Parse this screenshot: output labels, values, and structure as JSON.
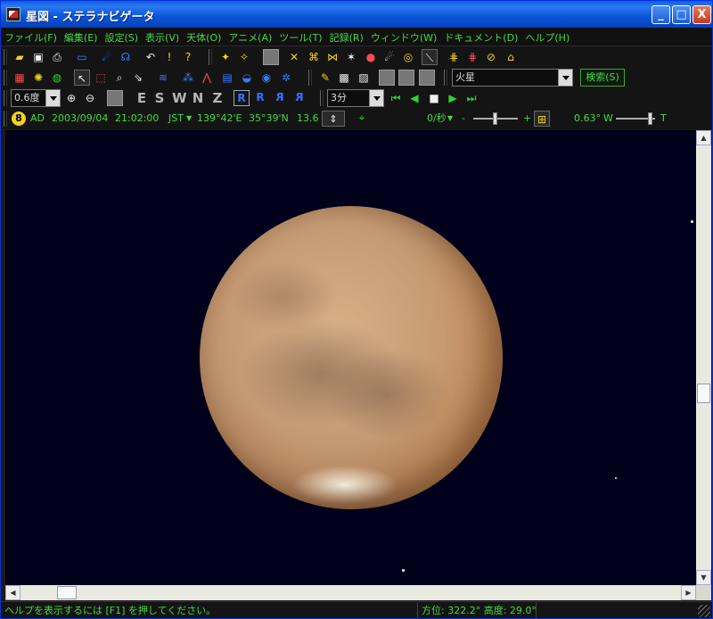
{
  "window": {
    "title": "星図 - ステラナビゲータ",
    "min_label": "_",
    "max_label": "□",
    "close_label": "X"
  },
  "menu": [
    {
      "id": "file",
      "label": "ファイル(F)"
    },
    {
      "id": "edit",
      "label": "編集(E)"
    },
    {
      "id": "settings",
      "label": "設定(S)"
    },
    {
      "id": "view",
      "label": "表示(V)"
    },
    {
      "id": "object",
      "label": "天体(O)"
    },
    {
      "id": "anime",
      "label": "アニメ(A)"
    },
    {
      "id": "tools",
      "label": "ツール(T)"
    },
    {
      "id": "record",
      "label": "記録(R)"
    },
    {
      "id": "window",
      "label": "ウィンドウ(W)"
    },
    {
      "id": "document",
      "label": "ドキュメント(D)"
    },
    {
      "id": "help",
      "label": "ヘルプ(H)"
    }
  ],
  "toolbar": {
    "object_search_value": "火星",
    "search_button": "検索(S)",
    "fov_value": "0.6度",
    "time_step_value": "3分",
    "directions": [
      "E",
      "S",
      "W",
      "N",
      "Z"
    ],
    "rotation_buttons": [
      "R",
      "R",
      "R",
      "R"
    ]
  },
  "status_row": {
    "era_number": "8",
    "era": "AD",
    "date": "2003/09/04",
    "time": "21:02:00",
    "timezone": "JST",
    "longitude": "139°42'E",
    "latitude": "35°39'N",
    "altitude_value": "13.6",
    "speed": "0/秒",
    "minus": "-",
    "plus": "+",
    "magnitude": "0.63°",
    "zoom_w": "W",
    "zoom_t": "T"
  },
  "statusbar": {
    "help_text": "ヘルプを表示するには [F1] を押してください。",
    "position_text": "方位: 322.2°  高度:  29.0°"
  },
  "colors": {
    "accent_green": "#46d946",
    "sky": "#00001a",
    "mars_body": "#c49a74"
  }
}
